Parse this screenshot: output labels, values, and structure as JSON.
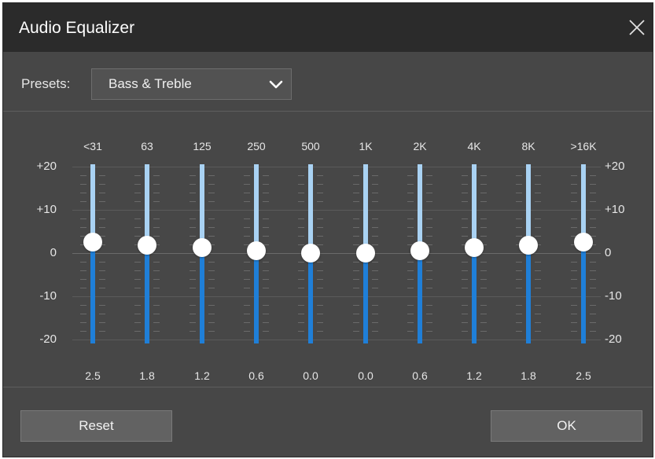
{
  "window": {
    "title": "Audio Equalizer",
    "close_icon": "close-icon"
  },
  "presets": {
    "label": "Presets:",
    "value": "Bass & Treble",
    "chevron_icon": "chevron-down-icon"
  },
  "scale": {
    "left": [
      "+20",
      "+10",
      "0",
      "-10",
      "-20"
    ],
    "right": [
      "+20",
      "+10",
      "0",
      "-10",
      "-20"
    ],
    "range": [
      -20,
      20
    ]
  },
  "bands": [
    {
      "freq": "<31",
      "gain_label": "2.5",
      "gain": 2.5
    },
    {
      "freq": "63",
      "gain_label": "1.8",
      "gain": 1.8
    },
    {
      "freq": "125",
      "gain_label": "1.2",
      "gain": 1.2
    },
    {
      "freq": "250",
      "gain_label": "0.6",
      "gain": 0.6
    },
    {
      "freq": "500",
      "gain_label": "0.0",
      "gain": 0.0
    },
    {
      "freq": "1K",
      "gain_label": "0.0",
      "gain": 0.0
    },
    {
      "freq": "2K",
      "gain_label": "0.6",
      "gain": 0.6
    },
    {
      "freq": "4K",
      "gain_label": "1.2",
      "gain": 1.2
    },
    {
      "freq": "8K",
      "gain_label": "1.8",
      "gain": 1.8
    },
    {
      "freq": ">16K",
      "gain_label": "2.5",
      "gain": 2.5
    }
  ],
  "buttons": {
    "reset": "Reset",
    "ok": "OK"
  },
  "colors": {
    "track_upper": "#a9d2f3",
    "track_lower": "#1f7fd8",
    "knob": "#ffffff",
    "dialog_bg": "#474747",
    "titlebar_bg": "#2b2b2b"
  }
}
